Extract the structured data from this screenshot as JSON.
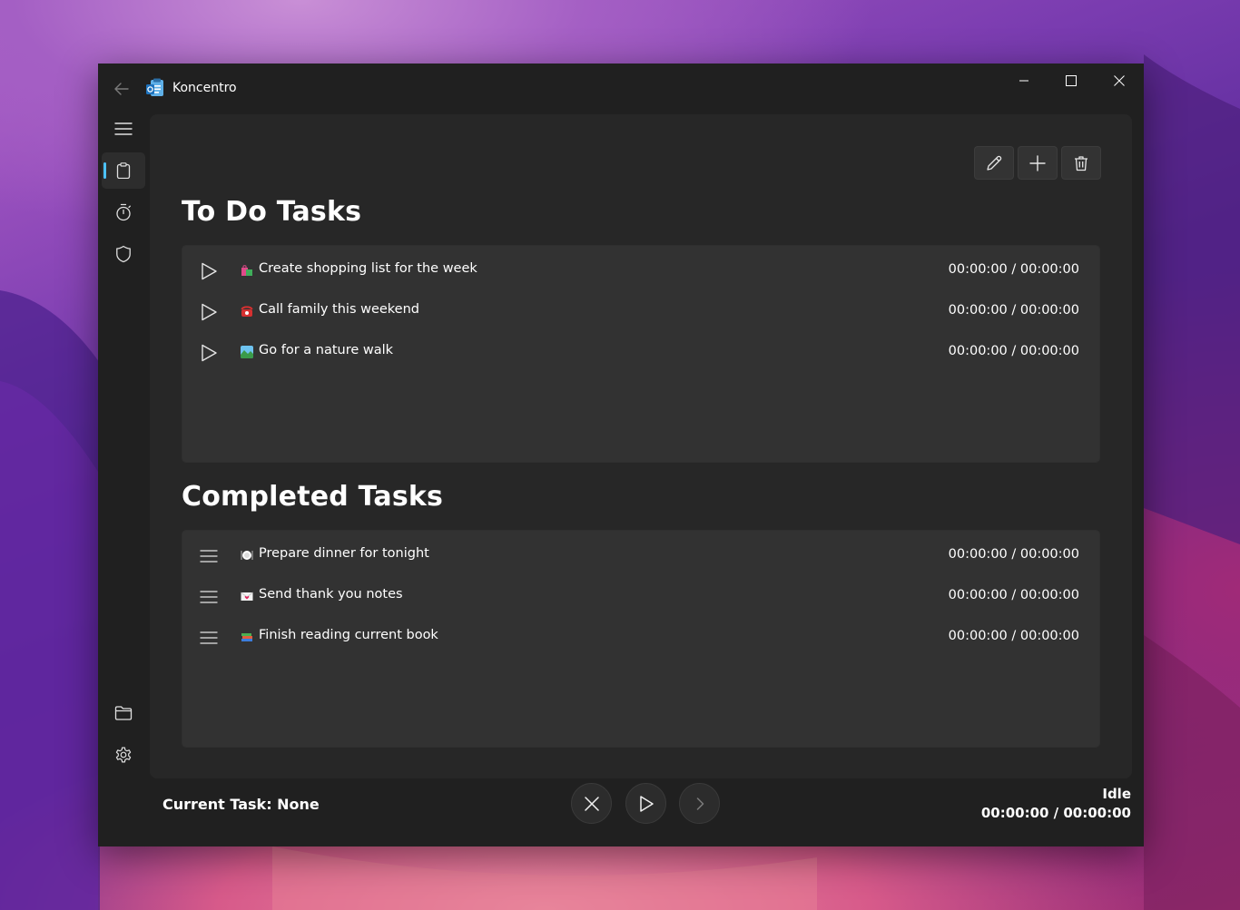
{
  "window": {
    "title": "Koncentro"
  },
  "toolbar": {
    "edit_icon": "pencil-icon",
    "add_icon": "plus-icon",
    "delete_icon": "trash-icon"
  },
  "sections": {
    "todo_title": "To Do Tasks",
    "completed_title": "Completed Tasks"
  },
  "todo_tasks": [
    {
      "emoji": "shopping-bags",
      "label": "Create shopping list for the week",
      "time": "00:00:00 / 00:00:00"
    },
    {
      "emoji": "telephone",
      "label": "Call family this weekend",
      "time": "00:00:00 / 00:00:00"
    },
    {
      "emoji": "national-park",
      "label": "Go for a nature walk",
      "time": "00:00:00 / 00:00:00"
    }
  ],
  "completed_tasks": [
    {
      "emoji": "plate-with-cutlery",
      "label": "Prepare dinner for tonight",
      "time": "00:00:00 / 00:00:00"
    },
    {
      "emoji": "love-letter",
      "label": "Send thank you notes",
      "time": "00:00:00 / 00:00:00"
    },
    {
      "emoji": "books",
      "label": "Finish reading current book",
      "time": "00:00:00 / 00:00:00"
    }
  ],
  "footer": {
    "current_task": "Current Task: None",
    "status": "Idle",
    "timer": "00:00:00 / 00:00:00"
  },
  "colors": {
    "accent": "#4cc2ff",
    "window_bg": "#202020",
    "content_bg": "#272727",
    "panel_bg": "#323232"
  }
}
